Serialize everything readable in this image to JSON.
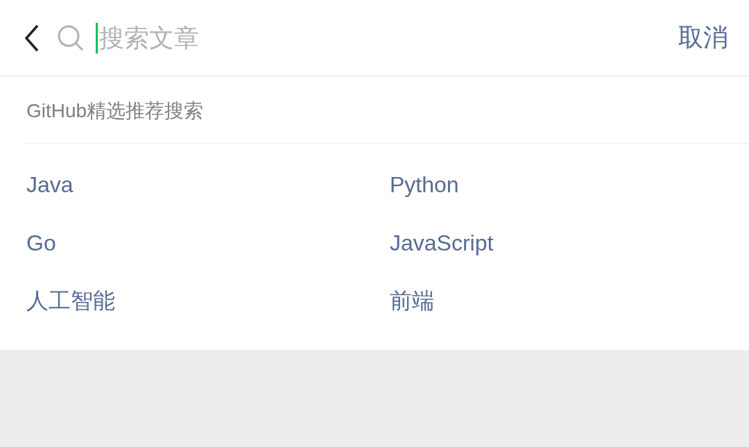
{
  "search_bar": {
    "placeholder": "搜索文章",
    "cancel": "取消"
  },
  "section": {
    "title": "GitHub精选推荐搜索"
  },
  "suggestions": [
    "Java",
    "Python",
    "Go",
    "JavaScript",
    "人工智能",
    "前端"
  ]
}
